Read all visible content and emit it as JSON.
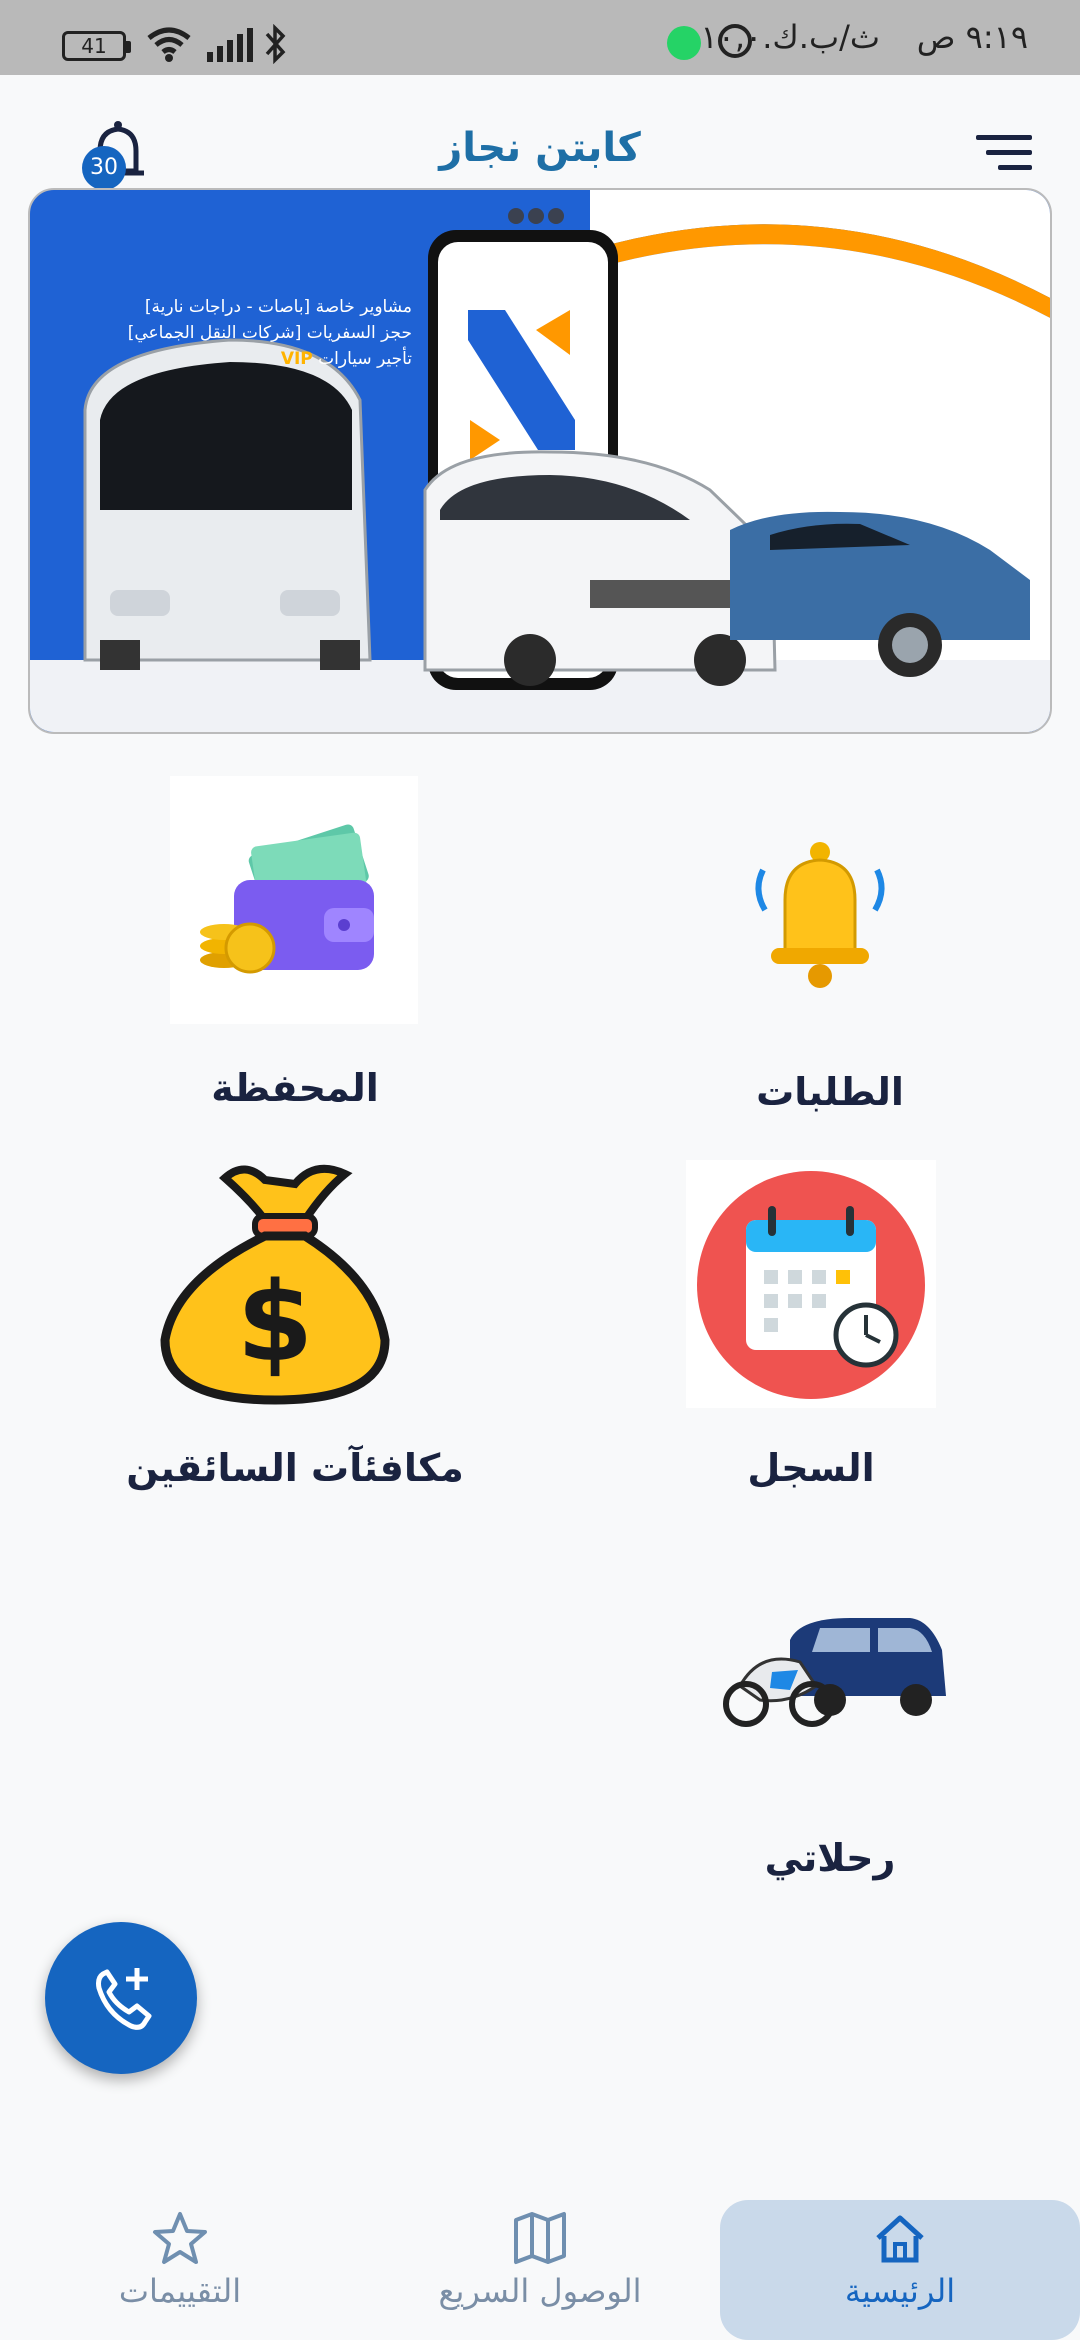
{
  "status_bar": {
    "time": "٩:١٩ ص",
    "date": "ث/ب.ك.١٠,٠",
    "battery": "41"
  },
  "header": {
    "title": "كابتن نجاز",
    "notifications_count": "30"
  },
  "banner": {
    "lines": [
      "مشاوير خاصة [باصات - دراجات نارية]",
      "حجز السفريات [شركات النقل الجماعي]",
      "تأجير سيارات"
    ],
    "vip": "VIP"
  },
  "grid": {
    "requests_label": "الطلبات",
    "wallet_label": "المحفظة",
    "history_label": "السجل",
    "rewards_label": "مكافئآت السائقين",
    "trips_label": "رحلاتي"
  },
  "bottom_nav": {
    "items": [
      {
        "label": "التقييمات",
        "icon": "star-icon"
      },
      {
        "label": "الوصول السريع",
        "icon": "map-icon"
      },
      {
        "label": "الرئيسية",
        "icon": "home-icon"
      }
    ]
  },
  "colors": {
    "primary": "#1565c0",
    "title": "#1e6fa6",
    "active_nav_bg": "#c9d9ea"
  }
}
